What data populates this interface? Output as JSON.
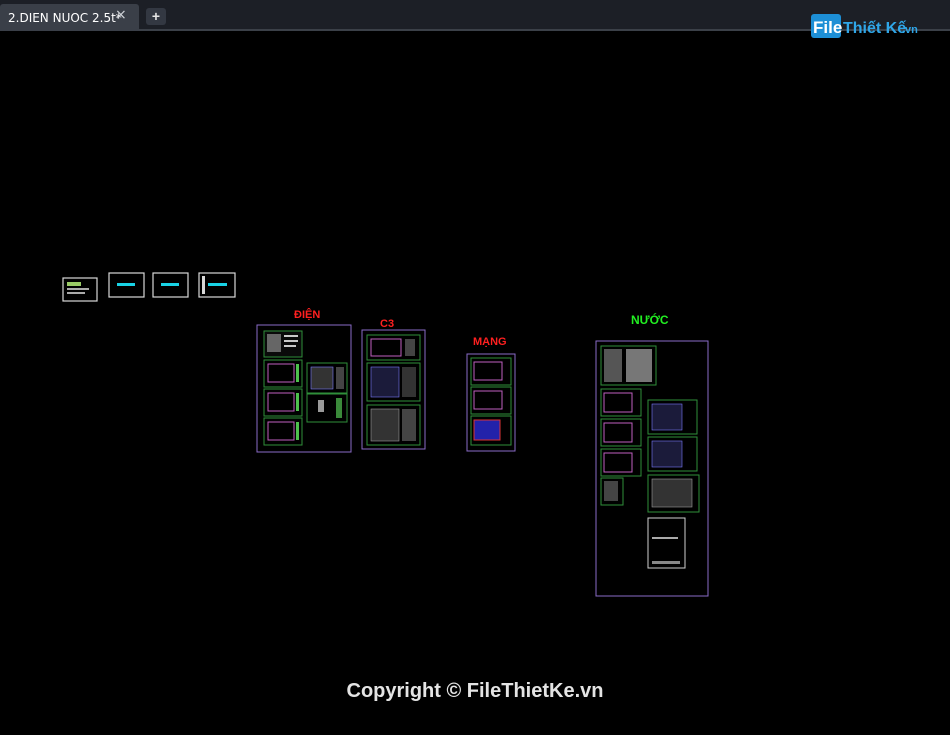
{
  "tab": {
    "label": "2.DIEN NUOC 2.5t*",
    "close_icon": "×",
    "new_tab_icon": "+"
  },
  "logo": {
    "part1": "File",
    "part2": "Thiết Kế",
    "part3": ".vn"
  },
  "sheets": {
    "dien": "ĐIỆN",
    "c3": "C3",
    "mang": "MẠNG",
    "nuoc": "NƯỚC"
  },
  "copyright": "Copyright © FileThietKe.vn",
  "colors": {
    "background": "#000000",
    "dien_label": "#ff2020",
    "c3_label": "#ff2020",
    "mang_label": "#ff2020",
    "nuoc_label": "#22ee22",
    "frame": "#8a6bc8",
    "sheet_border": "#2f8f3a",
    "cyan": "#19d3e6"
  }
}
